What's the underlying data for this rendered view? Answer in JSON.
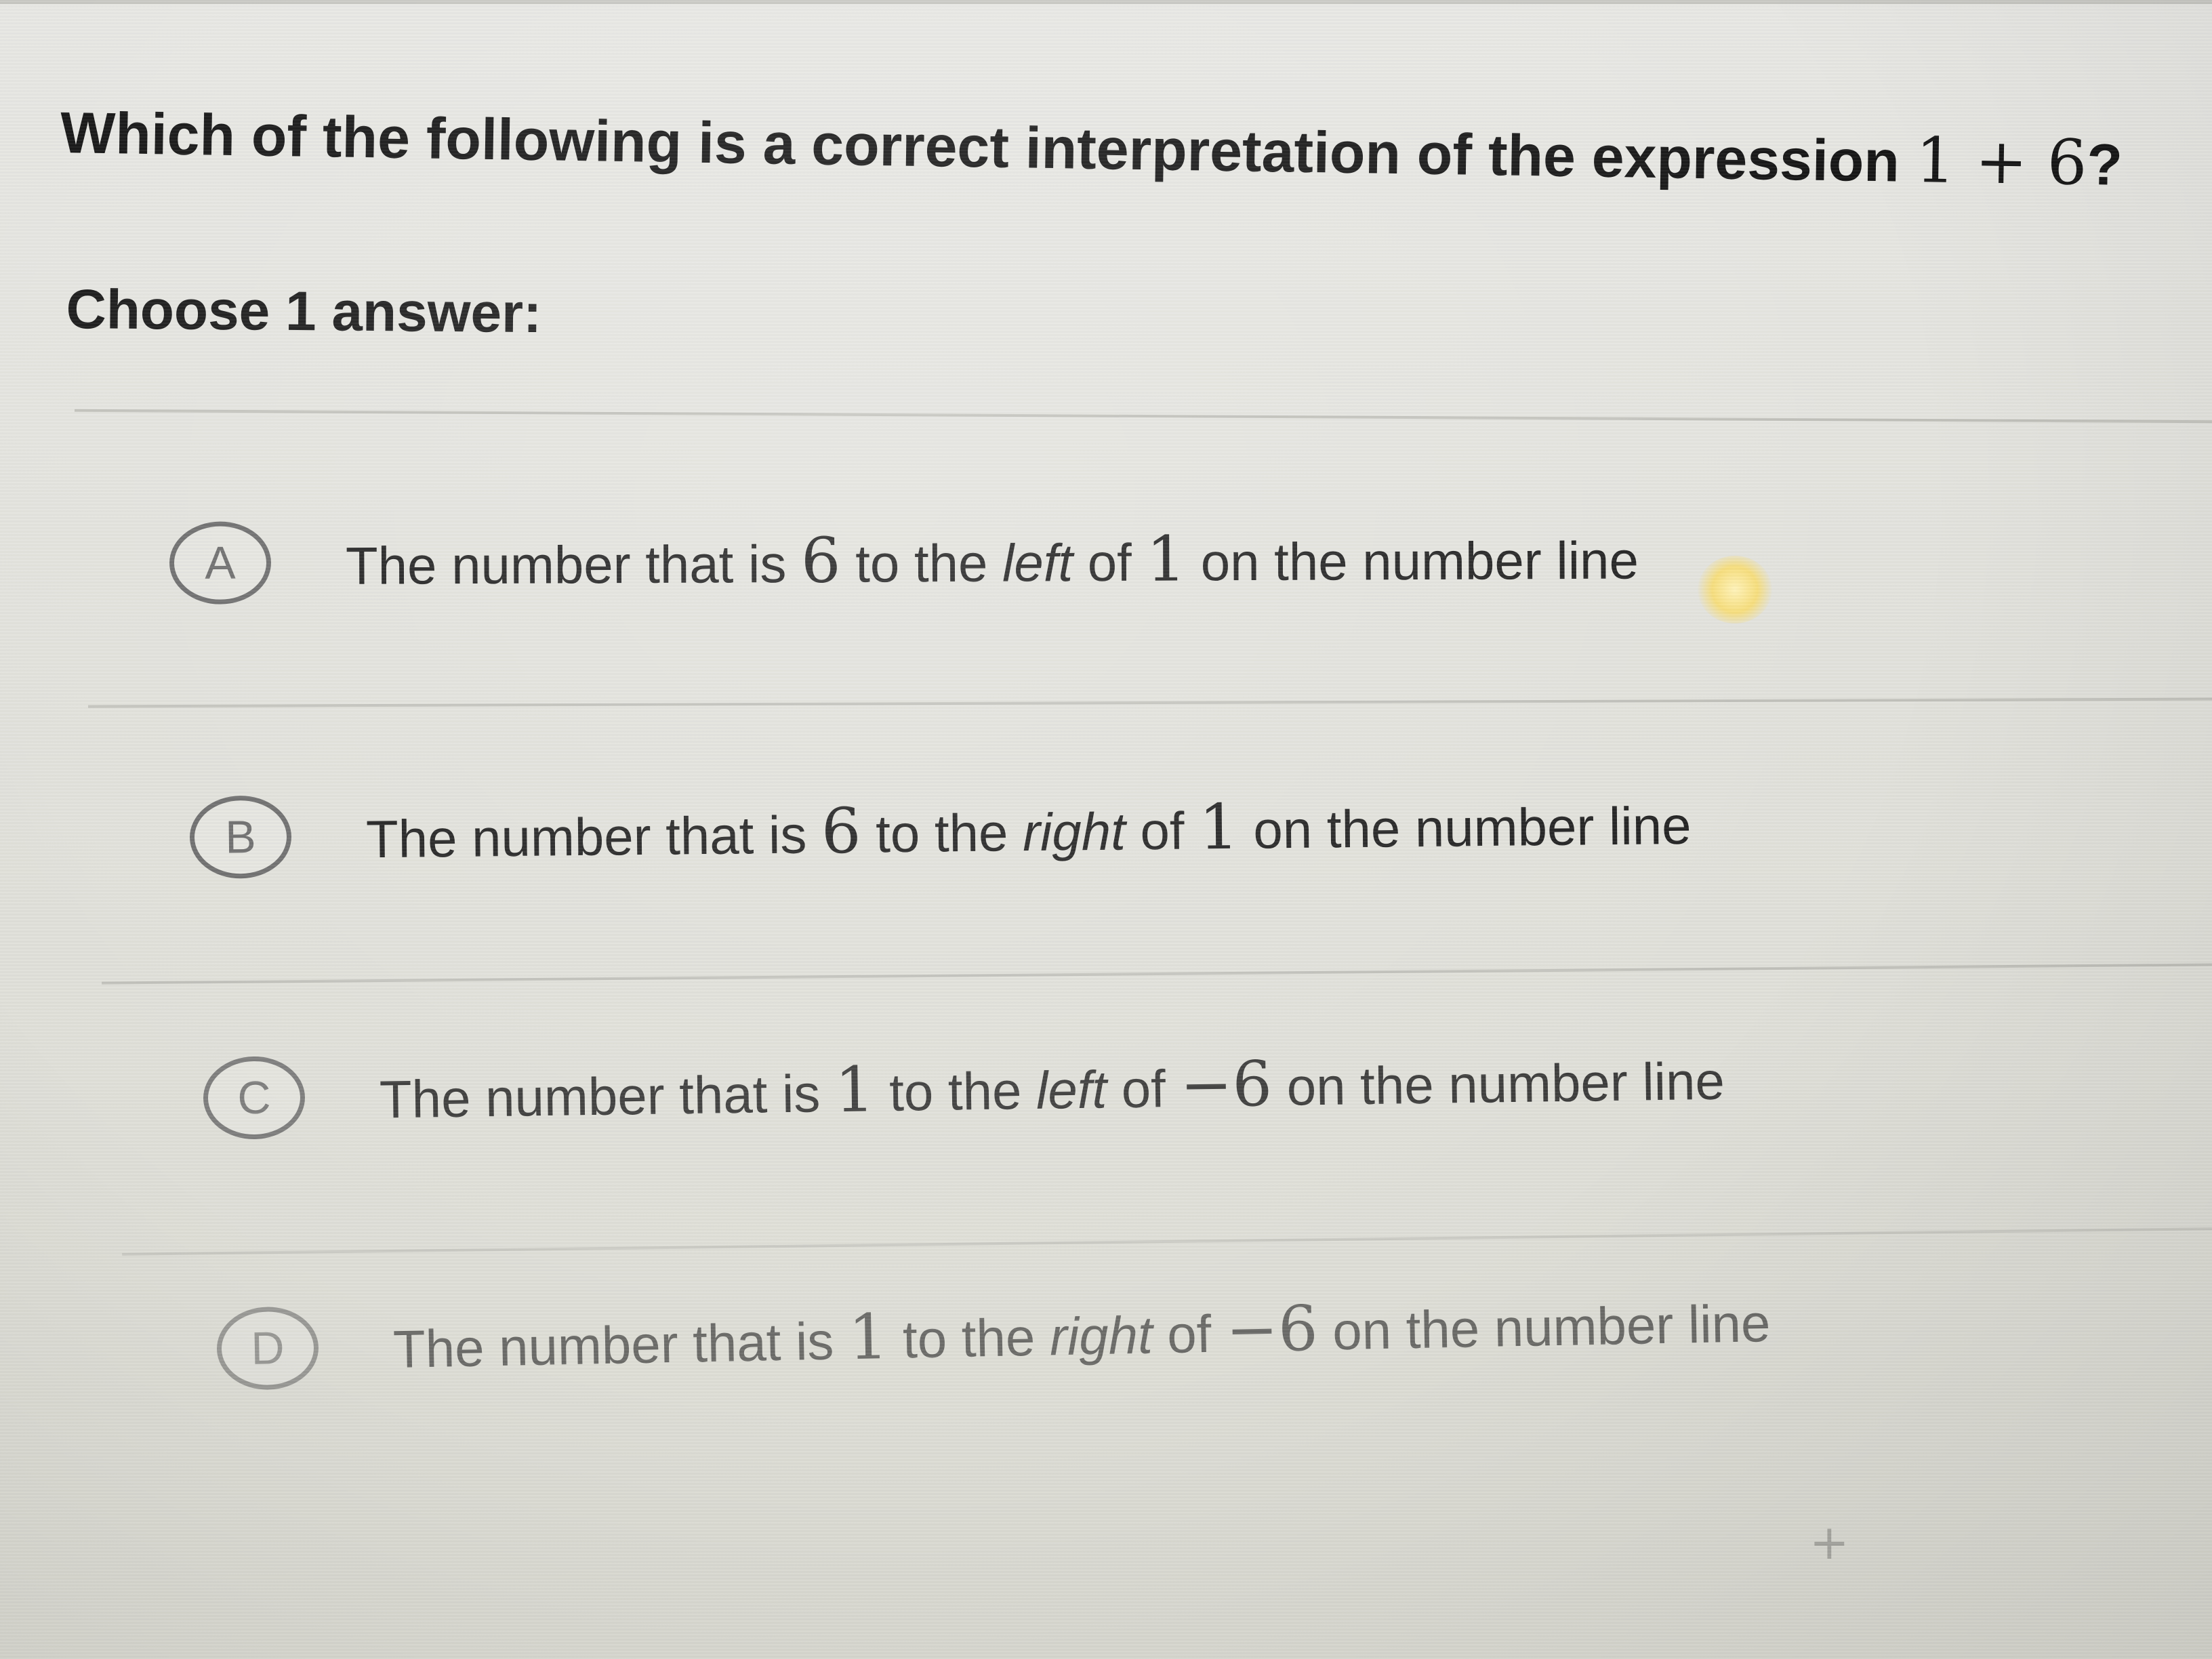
{
  "question": {
    "text": "Which of the following is a correct interpretation of the expression ",
    "expression": "1 + 6",
    "end": "?"
  },
  "instruction": "Choose 1 answer:",
  "choices": [
    {
      "letter": "A",
      "pre": "The number that is ",
      "n1": "6",
      "mid": " to the ",
      "dir": "left",
      "of": " of ",
      "n2": "1",
      "post": " on the number line"
    },
    {
      "letter": "B",
      "pre": "The number that is ",
      "n1": "6",
      "mid": " to the ",
      "dir": "right",
      "of": " of ",
      "n2": "1",
      "post": " on the number line"
    },
    {
      "letter": "C",
      "pre": "The number that is ",
      "n1": "1",
      "mid": " to the ",
      "dir": "left",
      "of": " of ",
      "n2": "−6",
      "post": " on the number line"
    },
    {
      "letter": "D",
      "pre": "The number that is ",
      "n1": "1",
      "mid": " to the ",
      "dir": "right",
      "of": " of ",
      "n2": "−6",
      "post": " on the number line"
    }
  ]
}
